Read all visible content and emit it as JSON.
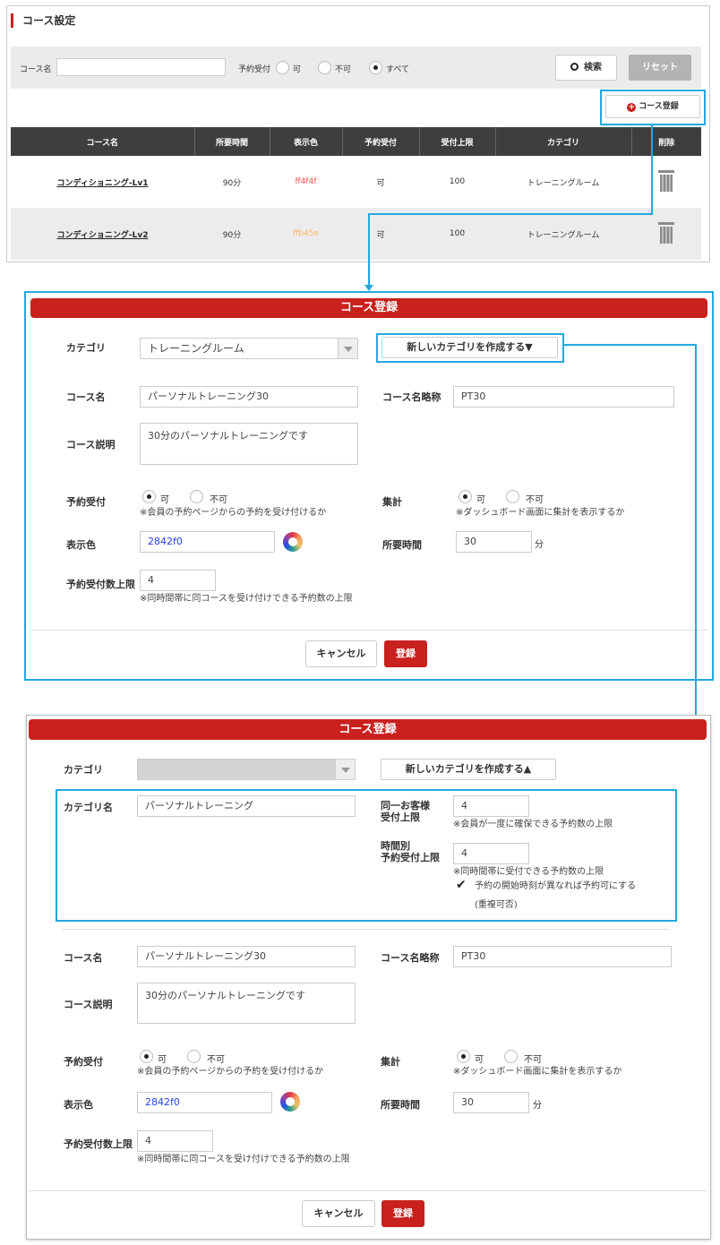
{
  "list": {
    "title": "コース設定",
    "search": {
      "course_label": "コース名",
      "course_value": "",
      "accept_label": "予約受付",
      "options": [
        "可",
        "不可",
        "すべて"
      ],
      "selected": "すべて",
      "search_button": "検索",
      "reset_button": "リセット"
    },
    "register_button": "コース登録",
    "columns": [
      "コース名",
      "所要時間",
      "表示色",
      "予約受付",
      "受付上限",
      "カテゴリ",
      "削除"
    ],
    "rows": [
      {
        "name": "コンディショニング-Lv1",
        "duration": "90分",
        "color": "ff4f4f",
        "color_hex": "#ff4f4f",
        "accept": "可",
        "limit": "100",
        "category": "トレーニングルーム"
      },
      {
        "name": "コンディショニング-Lv2",
        "duration": "90分",
        "color": "ffb45e",
        "color_hex": "#ffb45e",
        "accept": "可",
        "limit": "100",
        "category": "トレーニングルーム"
      }
    ]
  },
  "modal1": {
    "title": "コース登録",
    "category_label": "カテゴリ",
    "category_value": "トレーニングルーム",
    "new_category_button": "新しいカテゴリを作成する▼",
    "course_name_label": "コース名",
    "course_name_value": "パーソナルトレーニング30",
    "short_name_label": "コース名略称",
    "short_name_value": "PT30",
    "desc_label": "コース説明",
    "desc_value": "30分のパーソナルトレーニングです",
    "accept_label": "予約受付",
    "accept_opt_yes": "可",
    "accept_opt_no": "不可",
    "accept_note": "※会員の予約ページからの予約を受け付けるか",
    "stats_label": "集計",
    "stats_opt_yes": "可",
    "stats_opt_no": "不可",
    "stats_note": "※ダッシュボード画面に集計を表示するか",
    "color_label": "表示色",
    "color_value": "2842f0",
    "duration_label": "所要時間",
    "duration_value": "30",
    "duration_unit": "分",
    "limit_label": "予約受付数上限",
    "limit_value": "4",
    "limit_note": "※同時間帯に同コースを受け付けできる予約数の上限",
    "cancel_button": "キャンセル",
    "submit_button": "登録"
  },
  "modal2": {
    "title": "コース登録",
    "category_label": "カテゴリ",
    "category_value": "",
    "new_category_button": "新しいカテゴリを作成する▲",
    "category_name_label": "カテゴリ名",
    "category_name_value": "パーソナルトレーニング",
    "same_customer_label_1": "同一お客様",
    "same_customer_label_2": "受付上限",
    "same_customer_value": "4",
    "same_customer_note": "※会員が一度に確保できる予約数の上限",
    "timeslot_label_1": "時間別",
    "timeslot_label_2": "予約受付上限",
    "timeslot_value": "4",
    "timeslot_note": "※同時間帯に受付できる予約数の上限",
    "overlap_check_label": "予約の開始時刻が異なれば予約可にする",
    "overlap_sub": "(重複可否)",
    "course_name_label": "コース名",
    "course_name_value": "パーソナルトレーニング30",
    "short_name_label": "コース名略称",
    "short_name_value": "PT30",
    "desc_label": "コース説明",
    "desc_value": "30分のパーソナルトレーニングです",
    "accept_label": "予約受付",
    "accept_opt_yes": "可",
    "accept_opt_no": "不可",
    "accept_note": "※会員の予約ページからの予約を受け付けるか",
    "stats_label": "集計",
    "stats_opt_yes": "可",
    "stats_opt_no": "不可",
    "stats_note": "※ダッシュボード画面に集計を表示するか",
    "color_label": "表示色",
    "color_value": "2842f0",
    "duration_label": "所要時間",
    "duration_value": "30",
    "duration_unit": "分",
    "limit_label": "予約受付数上限",
    "limit_value": "4",
    "limit_note": "※同時間帯に同コースを受け付けできる予約数の上限",
    "cancel_button": "キャンセル",
    "submit_button": "登録"
  },
  "colors": {
    "accent": "#c9211e",
    "highlight": "#22a8de",
    "header_dark": "#3e3e3e",
    "link_blue": "#2842f0"
  }
}
